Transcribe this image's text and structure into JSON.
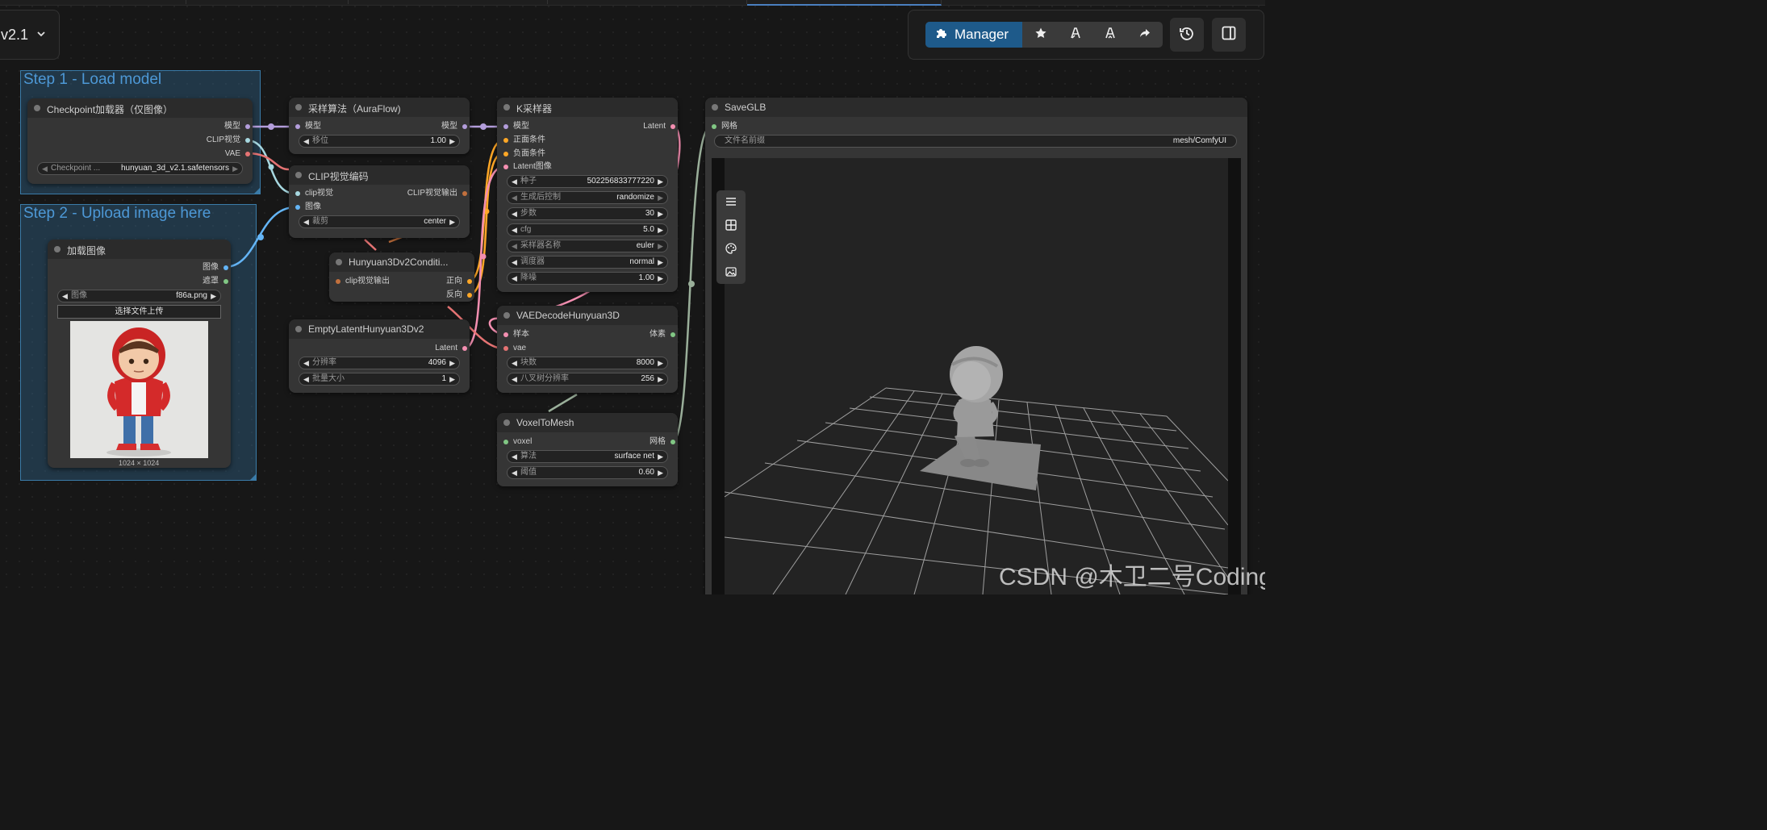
{
  "workflow_tab": {
    "title": "v2.1",
    "chevron_icon": "chevron-down-icon"
  },
  "toolbar": {
    "manager_label": "Manager",
    "manager_icon": "puzzle-piece-icon",
    "buttons": [
      "star-icon",
      "model-a-icon",
      "model-a-alt-icon",
      "share-icon"
    ],
    "history_icon": "history-icon",
    "panel_icon": "sidebar-panel-icon",
    "accent_color": "#1e5a8a"
  },
  "groups": {
    "step1": {
      "title": "Step 1 - Load model"
    },
    "step2": {
      "title": "Step 2 - Upload image here"
    }
  },
  "nodes": {
    "checkpoint": {
      "title": "Checkpoint加载器（仅图像）",
      "outputs": [
        "模型",
        "CLIP视觉",
        "VAE"
      ],
      "widget_label": "Checkpoint ...",
      "widget_value": "hunyuan_3d_v2.1.safetensors"
    },
    "load_image": {
      "title": "加载图像",
      "outputs": [
        "图像",
        "遮罩"
      ],
      "widget_label": "图像",
      "widget_value": "f86a.png",
      "upload_button": "选择文件上传",
      "image_caption": "1024 × 1024"
    },
    "sampling": {
      "title": "采样算法（AuraFlow)",
      "input": "模型",
      "output": "模型",
      "widget_label": "移位",
      "widget_value": "1.00"
    },
    "clip_encode": {
      "title": "CLIP视觉编码",
      "inputs": [
        "clip视觉",
        "图像"
      ],
      "output": "CLIP视觉输出",
      "widget_label": "裁剪",
      "widget_value": "center"
    },
    "hunyuan_cond": {
      "title": "Hunyuan3Dv2Conditi...",
      "input": "clip视觉输出",
      "outputs": [
        "正向",
        "反向"
      ]
    },
    "empty_latent": {
      "title": "EmptyLatentHunyuan3Dv2",
      "output": "Latent",
      "widgets": [
        {
          "label": "分辨率",
          "value": "4096"
        },
        {
          "label": "批量大小",
          "value": "1"
        }
      ]
    },
    "ksampler": {
      "title": "K采样器",
      "inputs": [
        "模型",
        "正面条件",
        "负面条件",
        "Latent图像"
      ],
      "output": "Latent",
      "widgets": [
        {
          "label": "种子",
          "value": "502256833777220"
        },
        {
          "label": "生成后控制",
          "value": "randomize"
        },
        {
          "label": "步数",
          "value": "30"
        },
        {
          "label": "cfg",
          "value": "5.0"
        },
        {
          "label": "采样器名称",
          "value": "euler"
        },
        {
          "label": "调度器",
          "value": "normal"
        },
        {
          "label": "降噪",
          "value": "1.00"
        }
      ]
    },
    "vae_decode": {
      "title": "VAEDecodeHunyuan3D",
      "inputs": [
        "样本",
        "vae"
      ],
      "output": "体素",
      "widgets": [
        {
          "label": "块数",
          "value": "8000"
        },
        {
          "label": "八叉树分辨率",
          "value": "256"
        }
      ]
    },
    "voxel_to_mesh": {
      "title": "VoxelToMesh",
      "input": "voxel",
      "output": "网格",
      "widgets": [
        {
          "label": "算法",
          "value": "surface net"
        },
        {
          "label": "阈值",
          "value": "0.60"
        }
      ]
    },
    "save_glb": {
      "title": "SaveGLB",
      "input": "网格",
      "widget_label": "文件名前缀",
      "widget_value": "mesh/ComfyUI",
      "viewer_tools": [
        "menu-icon",
        "grid-icon",
        "palette-icon",
        "image-icon"
      ]
    }
  },
  "watermark": "CSDN @木卫二号Coding"
}
